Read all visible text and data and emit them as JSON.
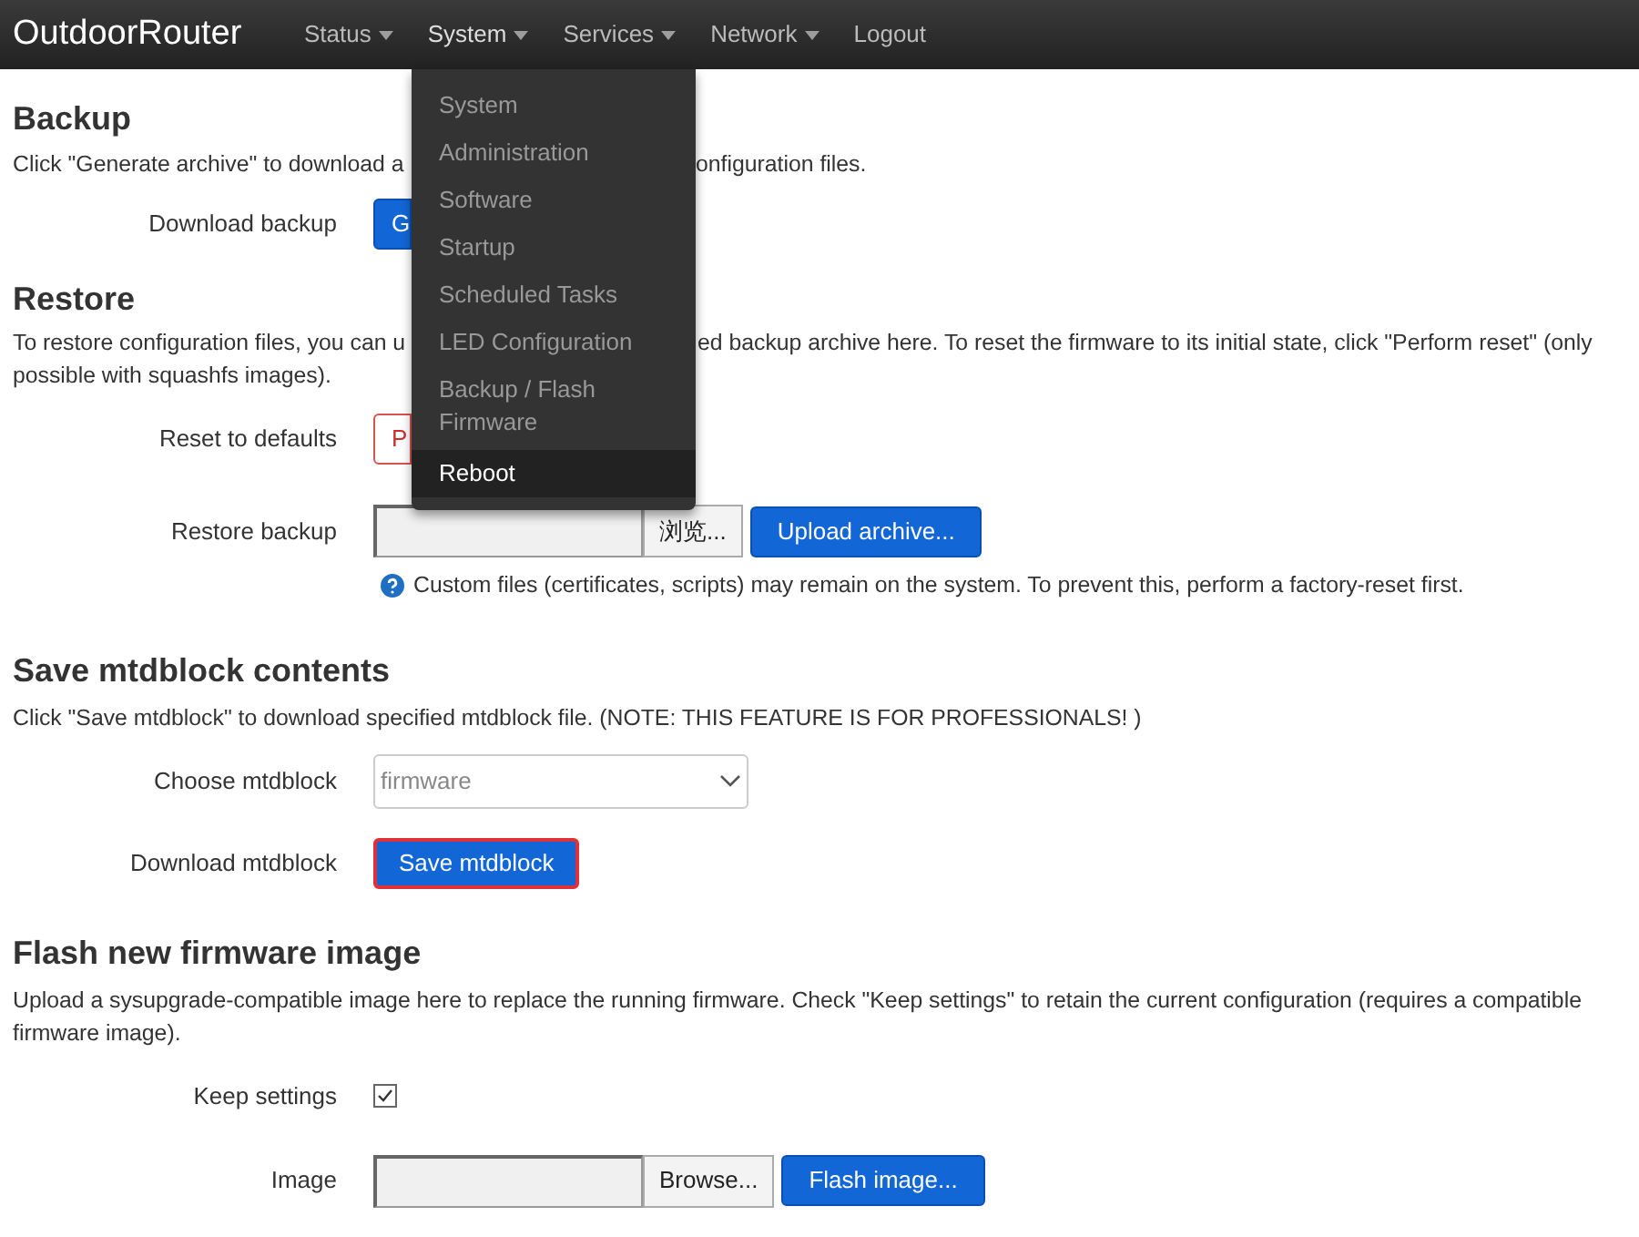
{
  "brand": "OutdoorRouter",
  "nav": [
    {
      "label": "Status",
      "dropdown": true,
      "selected": false
    },
    {
      "label": "System",
      "dropdown": true,
      "selected": true
    },
    {
      "label": "Services",
      "dropdown": true,
      "selected": false
    },
    {
      "label": "Network",
      "dropdown": true,
      "selected": false
    },
    {
      "label": "Logout",
      "dropdown": false,
      "selected": false
    }
  ],
  "menu": [
    {
      "label": "System",
      "selected": false
    },
    {
      "label": "Administration",
      "selected": false
    },
    {
      "label": "Software",
      "selected": false
    },
    {
      "label": "Startup",
      "selected": false
    },
    {
      "label": "Scheduled Tasks",
      "selected": false
    },
    {
      "label": "LED Configuration",
      "selected": false
    },
    {
      "label": "Backup / Flash Firmware",
      "selected": false
    },
    {
      "label": "Reboot",
      "selected": true
    }
  ],
  "backup": {
    "title": "Backup",
    "text_left": "Click \"Generate archive\" to download a",
    "text_right": "onfiguration files.",
    "rows": [
      {
        "label": "Download backup",
        "kind": "button",
        "button": "G"
      }
    ]
  },
  "restore": {
    "title": "Restore",
    "text_left": "To restore configuration files, you can u",
    "text_right": "ed backup archive here. To reset the firmware to its initial state, click \"Perform reset\" (only",
    "text_line2": "possible with squashfs images).",
    "rows": [
      {
        "label": "Reset to defaults",
        "kind": "button",
        "button": "P"
      },
      {
        "label": "Restore backup",
        "kind": "file",
        "browse": "浏览...",
        "button": "Upload archive..."
      }
    ],
    "hint": "Custom files (certificates, scripts) may remain on the system. To prevent this, perform a factory-reset first."
  },
  "mtd": {
    "title": "Save mtdblock contents",
    "text": "Click \"Save mtdblock\" to download specified mtdblock file. (NOTE: THIS FEATURE IS FOR PROFESSIONALS! )",
    "rows": [
      {
        "label": "Choose mtdblock",
        "kind": "select",
        "value": "firmware"
      },
      {
        "label": "Download mtdblock",
        "kind": "button",
        "button": "Save mtdblock"
      }
    ]
  },
  "flash": {
    "title": "Flash new firmware image",
    "text": "Upload a sysupgrade-compatible image here to replace the running firmware. Check \"Keep settings\" to retain the current configuration (requires a compatible firmware image).",
    "rows": [
      {
        "label": "Keep settings",
        "kind": "checkbox",
        "checked": true
      },
      {
        "label": "Image",
        "kind": "file",
        "browse": "Browse...",
        "button": "Flash image..."
      }
    ]
  }
}
